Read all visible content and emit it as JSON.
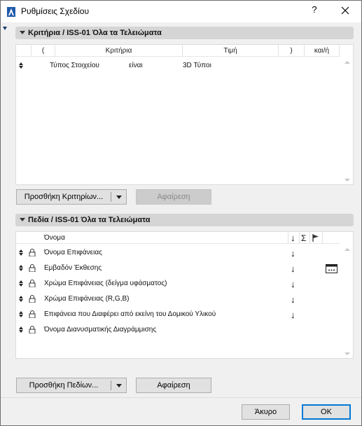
{
  "window": {
    "title": "Ρυθμίσεις Σχεδίου",
    "help_label": "?",
    "close_label": "✕"
  },
  "criteria_section": {
    "title": "Κριτήρια / ISS-01 Όλα τα Τελειώματα",
    "headers": [
      "(",
      "Κριτήρια",
      "Τιμή",
      ")",
      "και/ή"
    ],
    "rows": [
      {
        "paren_open": "",
        "criterion": "Τύπος Στοιχείου",
        "operator": "είναι",
        "value": "3D Τύποι",
        "paren_close": "",
        "and_or": ""
      }
    ],
    "add_button": "Προσθήκη Κριτηρίων...",
    "remove_button": "Αφαίρεση"
  },
  "fields_section": {
    "title": "Πεδία / ISS-01 Όλα τα Τελειώματα",
    "headers": {
      "name": "Όνομα",
      "sort": "↓",
      "sum": "Σ",
      "flag": "flag-icon"
    },
    "rows": [
      {
        "name": "Όνομα Επιφάνειας",
        "sort": "↓"
      },
      {
        "name": "Εμβαδόν Έκθεσης",
        "sort": "↓"
      },
      {
        "name": "Χρώμα Επιφάνειας (δείγμα υφάσματος)",
        "sort": "↓"
      },
      {
        "name": "Χρώμα Επιφάνειας (R,G,B)",
        "sort": "↓"
      },
      {
        "name": "Επιφάνεια που Διαφέρει από εκείνη του Δομικού Υλικού",
        "sort": "↓"
      },
      {
        "name": "Όνομα Διανυσματικής Διαγράμμισης",
        "sort": "↓"
      }
    ],
    "add_button": "Προσθήκη Πεδίων...",
    "remove_button": "Αφαίρεση"
  },
  "footer": {
    "cancel_button": "Άκυρο",
    "ok_button": "OK"
  },
  "colors": {
    "accent": "#0078d7",
    "section_header": "#d5d5d5",
    "dialog_bg": "#f0f0f0"
  }
}
